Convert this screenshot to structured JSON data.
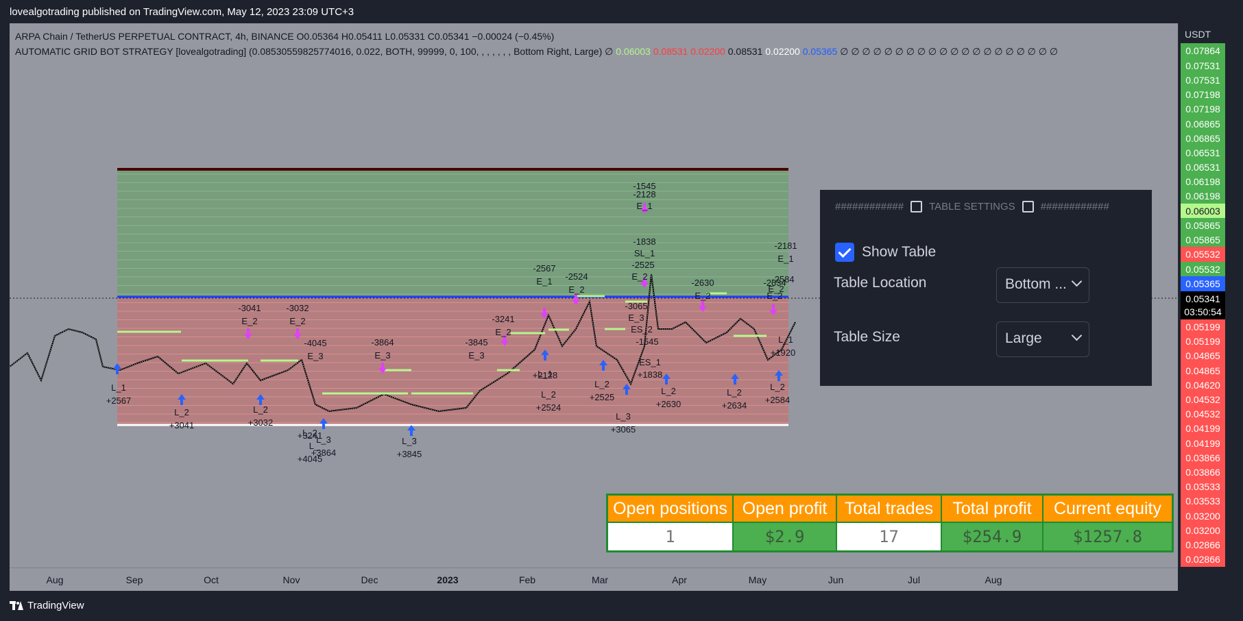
{
  "header": {
    "published": "lovealgotrading published on TradingView.com, May 12, 2023 23:09 UTC+3"
  },
  "legend": {
    "symbol_line": "ARPA Chain / TetherUS PERPETUAL CONTRACT, 4h, BINANCE  O0.05364  H0.05411  L0.05331  C0.05341  −0.00024 (−0.45%)",
    "strategy_line": "AUTOMATIC GRID BOT STRATEGY [lovealgotrading] (0.08530559825774016, 0.022, BOTH, 99999, 0, 100, , , , , , , Bottom Right, Large)  ∅",
    "values": [
      {
        "text": "0.06003",
        "color": "#b5f78c"
      },
      {
        "text": "0.08531",
        "color": "#ff3b3b"
      },
      {
        "text": "0.02200",
        "color": "#ff3b3b"
      },
      {
        "text": "0.08531",
        "color": "#131722"
      },
      {
        "text": "0.02200",
        "color": "#ffffff"
      },
      {
        "text": "0.05365",
        "color": "#1f5cff"
      }
    ],
    "trailing": "∅  ∅  ∅  ∅  ∅  ∅  ∅  ∅  ∅  ∅  ∅  ∅  ∅  ∅  ∅  ∅  ∅  ∅  ∅  ∅"
  },
  "price_axis": {
    "currency": "USDT",
    "labels": [
      {
        "text": "0.07864",
        "color": "#4caf50"
      },
      {
        "text": "0.07531",
        "color": "#4caf50"
      },
      {
        "text": "0.07531",
        "color": "#4caf50"
      },
      {
        "text": "0.07198",
        "color": "#4caf50"
      },
      {
        "text": "0.07198",
        "color": "#4caf50"
      },
      {
        "text": "0.06865",
        "color": "#4caf50"
      },
      {
        "text": "0.06865",
        "color": "#4caf50"
      },
      {
        "text": "0.06531",
        "color": "#4caf50"
      },
      {
        "text": "0.06531",
        "color": "#4caf50"
      },
      {
        "text": "0.06198",
        "color": "#4caf50"
      },
      {
        "text": "0.06198",
        "color": "#4caf50"
      },
      {
        "text": "0.06003",
        "color": "#b5f78c"
      },
      {
        "text": "0.05865",
        "color": "#4caf50"
      },
      {
        "text": "0.05865",
        "color": "#4caf50"
      },
      {
        "text": "0.05532",
        "color": "#ff5252"
      },
      {
        "text": "0.05532",
        "color": "#4caf50"
      },
      {
        "text": "0.05365",
        "color": "#2962ff"
      },
      {
        "text": "0.05341",
        "color": "#000000"
      },
      {
        "text": "03:50:54",
        "color": "#000000"
      },
      {
        "text": "0.05199",
        "color": "#ff5252"
      },
      {
        "text": "0.05199",
        "color": "#ff5252"
      },
      {
        "text": "0.04865",
        "color": "#ff5252"
      },
      {
        "text": "0.04865",
        "color": "#ff5252"
      },
      {
        "text": "0.04620",
        "color": "#ff5252"
      },
      {
        "text": "0.04532",
        "color": "#ff5252"
      },
      {
        "text": "0.04532",
        "color": "#ff5252"
      },
      {
        "text": "0.04199",
        "color": "#ff5252"
      },
      {
        "text": "0.04199",
        "color": "#ff5252"
      },
      {
        "text": "0.03866",
        "color": "#ff5252"
      },
      {
        "text": "0.03866",
        "color": "#ff5252"
      },
      {
        "text": "0.03533",
        "color": "#ff5252"
      },
      {
        "text": "0.03533",
        "color": "#ff5252"
      },
      {
        "text": "0.03200",
        "color": "#ff5252"
      },
      {
        "text": "0.03200",
        "color": "#ff5252"
      },
      {
        "text": "0.02866",
        "color": "#ff5252"
      },
      {
        "text": "0.02866",
        "color": "#ff5252"
      }
    ]
  },
  "time_axis": {
    "labels": [
      {
        "text": "Aug",
        "bold": false
      },
      {
        "text": "Sep",
        "bold": false
      },
      {
        "text": "Oct",
        "bold": false
      },
      {
        "text": "Nov",
        "bold": false
      },
      {
        "text": "Dec",
        "bold": false
      },
      {
        "text": "2023",
        "bold": true
      },
      {
        "text": "Feb",
        "bold": false
      },
      {
        "text": "Mar",
        "bold": false
      },
      {
        "text": "Apr",
        "bold": false
      },
      {
        "text": "May",
        "bold": false
      },
      {
        "text": "Jun",
        "bold": false
      },
      {
        "text": "Jul",
        "bold": false
      },
      {
        "text": "Aug",
        "bold": false
      }
    ]
  },
  "trade_labels": [
    "L_1",
    "+2567",
    "L_2",
    "+3041",
    "L_2",
    "+3032",
    "L_2",
    "+3241",
    "L_3",
    "+3864",
    "L_",
    "+4045",
    "L_3",
    "+3845",
    "L_1",
    "+2128",
    "L_2",
    "+2524",
    "L_2",
    "+2525",
    "L_3",
    "+3065",
    "L_2",
    "+2630",
    "L_2",
    "+2634",
    "L_2",
    "+2584",
    "ES_1",
    "+1838",
    "L_1",
    "+1920",
    "-3041",
    "E_2",
    "-3032",
    "E_2",
    "-4045",
    "E_3",
    "-3864",
    "E_3",
    "-3845",
    "E_3",
    "-3241",
    "E_2",
    "-2567",
    "E_1",
    "-2524",
    "E_2",
    "-1545",
    "-2128",
    "E_1",
    "-1838",
    "SL_1",
    "-2525",
    "E_2",
    "-3065",
    "E_3",
    "ES_2",
    "-1545",
    "-2630",
    "E_2",
    "-2181",
    "E_1",
    "-2584",
    "E_2",
    "-2634",
    "E_2"
  ],
  "settings_panel": {
    "header_left": "############",
    "header_title": "TABLE SETTINGS",
    "header_right": "############",
    "show_table_label": "Show Table",
    "show_table_checked": true,
    "table_location_label": "Table Location",
    "table_location_value": "Bottom ...",
    "table_size_label": "Table Size",
    "table_size_value": "Large"
  },
  "stats_table": {
    "headers": [
      "Open positions",
      "Open profit",
      "Total trades",
      "Total profit",
      "Current equity"
    ],
    "values": [
      "1",
      "$2.9",
      "17",
      "$254.9",
      "$1257.8"
    ]
  },
  "footer": {
    "brand": "TradingView"
  }
}
